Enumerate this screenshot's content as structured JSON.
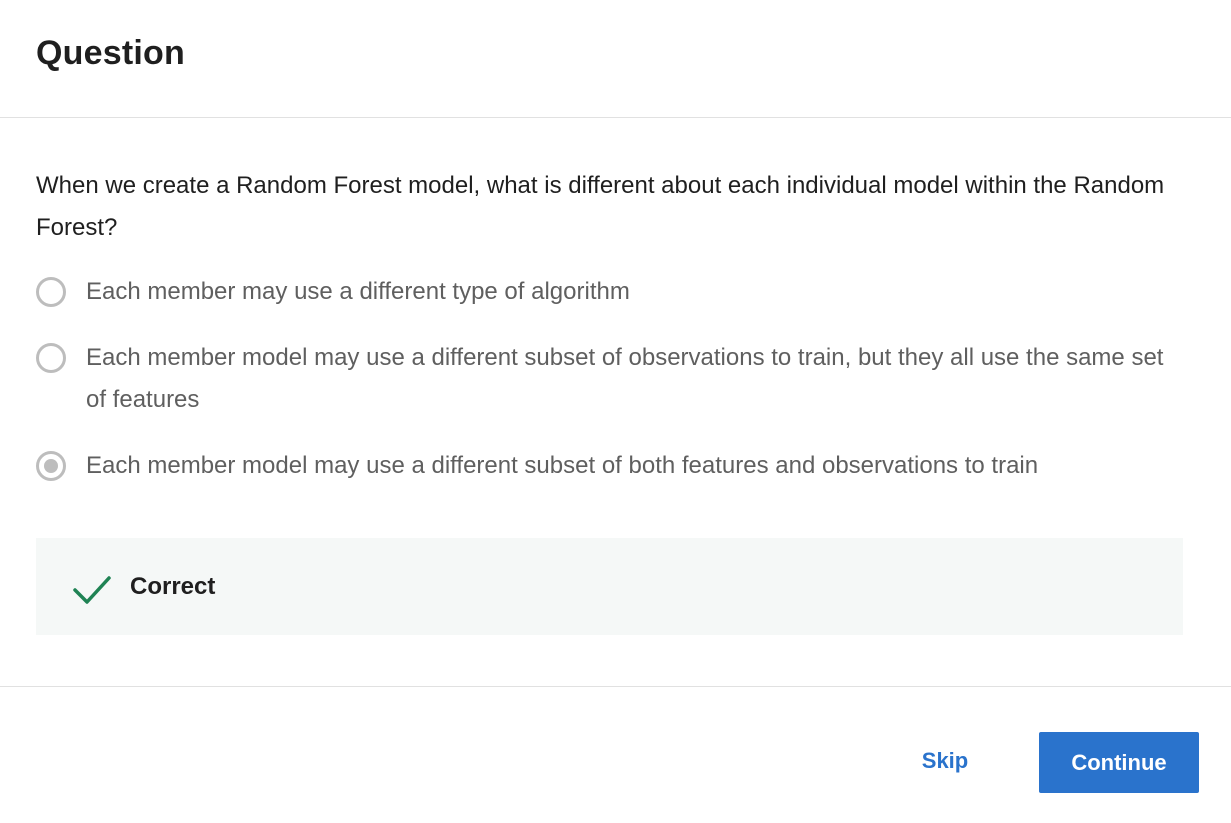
{
  "header": {
    "title": "Question"
  },
  "question": {
    "text": "When we create a Random Forest model, what is different about each individual model within the Random Forest?"
  },
  "options": [
    {
      "label": "Each member may use a different type of algorithm",
      "selected": false
    },
    {
      "label": "Each member model may use a different subset of observations to train, but they all use the same set of features",
      "selected": false
    },
    {
      "label": "Each member model may use a different subset of both features and observations to train",
      "selected": true
    }
  ],
  "feedback": {
    "status": "Correct",
    "icon": "check-icon",
    "color": "#1f8354"
  },
  "footer": {
    "skip_label": "Skip",
    "continue_label": "Continue",
    "accent_color": "#2a73cc"
  }
}
